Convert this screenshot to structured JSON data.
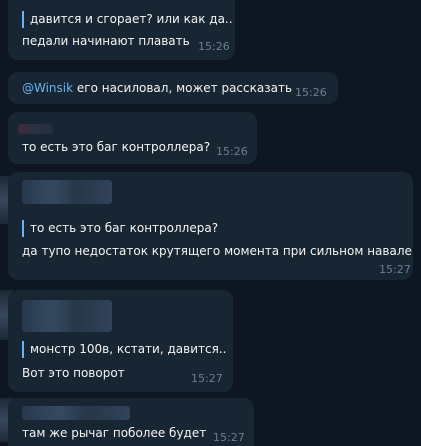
{
  "messages": [
    {
      "reply_text": "давится и сгорает? или как да...",
      "text": "педали начинают плавать",
      "time": "15:26"
    },
    {
      "mention": "@Winsik",
      "text": " его насиловал, может рассказать",
      "time": "15:26"
    },
    {
      "text": "то есть это баг контроллера?",
      "time": "15:26"
    },
    {
      "reply_text": "то есть это баг контроллера?",
      "text": "да тупо недостаток крутящего момента при сильном навале",
      "time": "15:27"
    },
    {
      "reply_text": "монстр 100в, кстати, давится...",
      "text": "Вот это поворот",
      "time": "15:27"
    },
    {
      "text": "там же рычаг поболее будет",
      "time": "15:27"
    }
  ],
  "colors": {
    "background": "#0e1621",
    "bubble": "#182533",
    "accent": "#6ab2f2",
    "time": "#6d7f8f"
  }
}
